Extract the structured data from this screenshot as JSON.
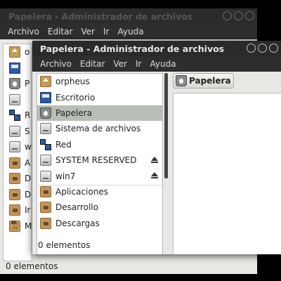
{
  "back_window": {
    "title": "Papelera - Administrador de archivos",
    "menu": [
      "Archivo",
      "Editar",
      "Ver",
      "Ir",
      "Ayuda"
    ],
    "sidebar_partial_labels": [
      "o",
      "",
      "P",
      "",
      "R",
      "S",
      "w",
      "A",
      "D",
      "D",
      "Ir",
      "M"
    ],
    "status": "0 elementos"
  },
  "front_window": {
    "title": "Papelera - Administrador de archivos",
    "menu": [
      "Archivo",
      "Editar",
      "Ver",
      "Ir",
      "Ayuda"
    ],
    "places": [
      {
        "label": "orpheus",
        "icon": "home-folder-icon"
      },
      {
        "label": "Escritorio",
        "icon": "desktop-icon"
      },
      {
        "label": "Papelera",
        "icon": "trash-icon",
        "selected": true
      },
      {
        "label": "Sistema de archivos",
        "icon": "filesystem-drive-icon"
      },
      {
        "label": "Red",
        "icon": "network-icon"
      }
    ],
    "devices": [
      {
        "label": "SYSTEM RESERVED",
        "icon": "drive-icon",
        "eject": true
      },
      {
        "label": "win7",
        "icon": "drive-icon",
        "eject": true
      }
    ],
    "bookmarks": [
      {
        "label": "Aplicaciones",
        "icon": "folder-applications-icon"
      },
      {
        "label": "Desarrollo",
        "icon": "folder-development-icon"
      },
      {
        "label": "Descargas",
        "icon": "folder-downloads-icon"
      }
    ],
    "path_label": "Papelera",
    "status": "0 elementos"
  }
}
